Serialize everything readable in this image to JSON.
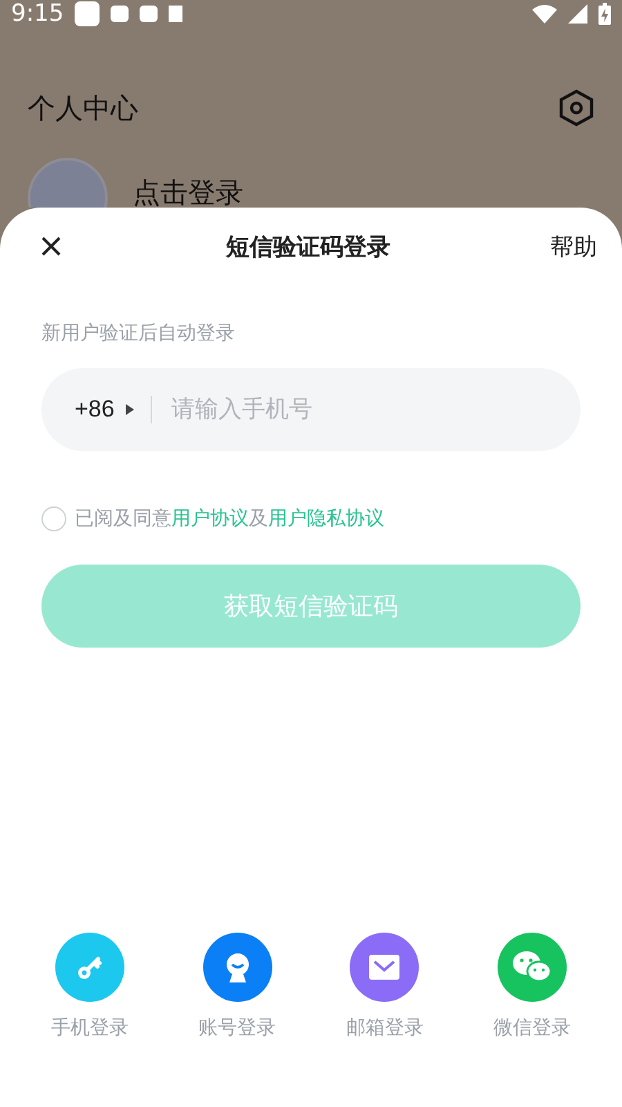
{
  "status_bar": {
    "time": "9:15"
  },
  "background": {
    "title": "个人中心",
    "login_prompt": "点击登录"
  },
  "sheet": {
    "title": "短信验证码登录",
    "help": "帮助",
    "hint": "新用户验证后自动登录",
    "country_code": "+86",
    "phone_placeholder": "请输入手机号",
    "agreement": {
      "checked": false,
      "prefix": "已阅及同意",
      "links": [
        "用户协议",
        "用户隐私协议"
      ],
      "joiner": "及"
    },
    "submit": {
      "label": "获取短信验证码",
      "disabled": true
    },
    "login_options": [
      {
        "kind": "phone",
        "label": "手机登录",
        "color": "#1cc8ee"
      },
      {
        "kind": "account",
        "label": "账号登录",
        "color": "#0b7ff5"
      },
      {
        "kind": "email",
        "label": "邮箱登录",
        "color": "#8a6cf7"
      },
      {
        "kind": "wechat",
        "label": "微信登录",
        "color": "#17c35f"
      }
    ]
  }
}
